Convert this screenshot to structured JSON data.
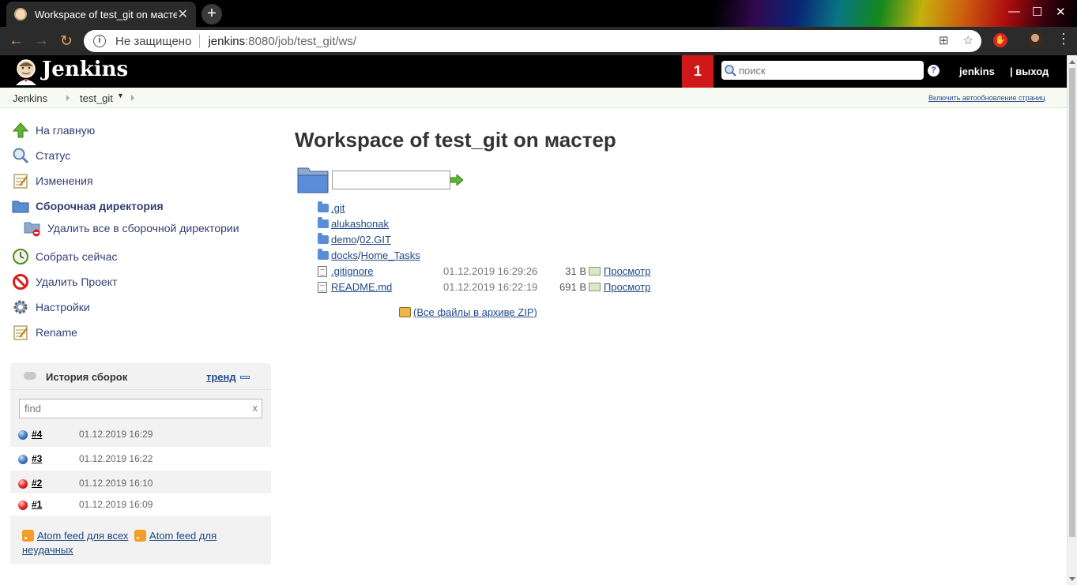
{
  "browser": {
    "tab_title": "Workspace of test_git on масте",
    "address": {
      "security_label": "Не защищено",
      "host": "jenkins",
      "path": ":8080/job/test_git/ws/"
    }
  },
  "header": {
    "logo": "Jenkins",
    "alert_count": "1",
    "search_placeholder": "поиск",
    "user": "jenkins",
    "logout": "| выход"
  },
  "breadcrumbs": {
    "items": [
      "Jenkins",
      "test_git"
    ],
    "autorefresh": "Включить автообновление страниц"
  },
  "sidebar": {
    "tasks": [
      {
        "label": "На главную",
        "icon": "up-arrow-icon"
      },
      {
        "label": "Статус",
        "icon": "magnifier-icon"
      },
      {
        "label": "Изменения",
        "icon": "notepad-icon"
      },
      {
        "label": "Сборочная директория",
        "icon": "folder-icon"
      },
      {
        "label": "Удалить все в сборочной директории",
        "icon": "folder-delete-icon"
      },
      {
        "label": "Собрать сейчас",
        "icon": "clock-icon"
      },
      {
        "label": "Удалить Проект",
        "icon": "no-entry-icon"
      },
      {
        "label": "Настройки",
        "icon": "gear-icon"
      },
      {
        "label": "Rename",
        "icon": "notepad-icon"
      }
    ]
  },
  "build_history": {
    "title": "История сборок",
    "trend": "тренд",
    "find_placeholder": "find",
    "find_clear": "x",
    "builds": [
      {
        "number": "#4",
        "date": "01.12.2019 16:29",
        "status": "blue"
      },
      {
        "number": "#3",
        "date": "01.12.2019 16:22",
        "status": "blue"
      },
      {
        "number": "#2",
        "date": "01.12.2019 16:10",
        "status": "red"
      },
      {
        "number": "#1",
        "date": "01.12.2019 16:09",
        "status": "red"
      }
    ],
    "feed_all": "Atom feed для всех",
    "feed_failed_1": "Atom feed для",
    "feed_failed_2": "неудачных"
  },
  "main": {
    "title": "Workspace of test_git on мастер",
    "entries": [
      {
        "type": "dir",
        "parts": [
          ".git"
        ]
      },
      {
        "type": "dir",
        "parts": [
          "alukashonak"
        ]
      },
      {
        "type": "dir",
        "parts": [
          "demo",
          "02.GIT"
        ]
      },
      {
        "type": "dir",
        "parts": [
          "docks",
          "Home_Tasks"
        ]
      },
      {
        "type": "file",
        "parts": [
          ".gitignore"
        ],
        "date": "01.12.2019 16:29:26",
        "size": "31 B",
        "view": "Просмотр"
      },
      {
        "type": "file",
        "parts": [
          "README.md"
        ],
        "date": "01.12.2019 16:22:19",
        "size": "691 B",
        "view": "Просмотр"
      }
    ],
    "zip_link": "(Все файлы в архиве ZIP)"
  }
}
